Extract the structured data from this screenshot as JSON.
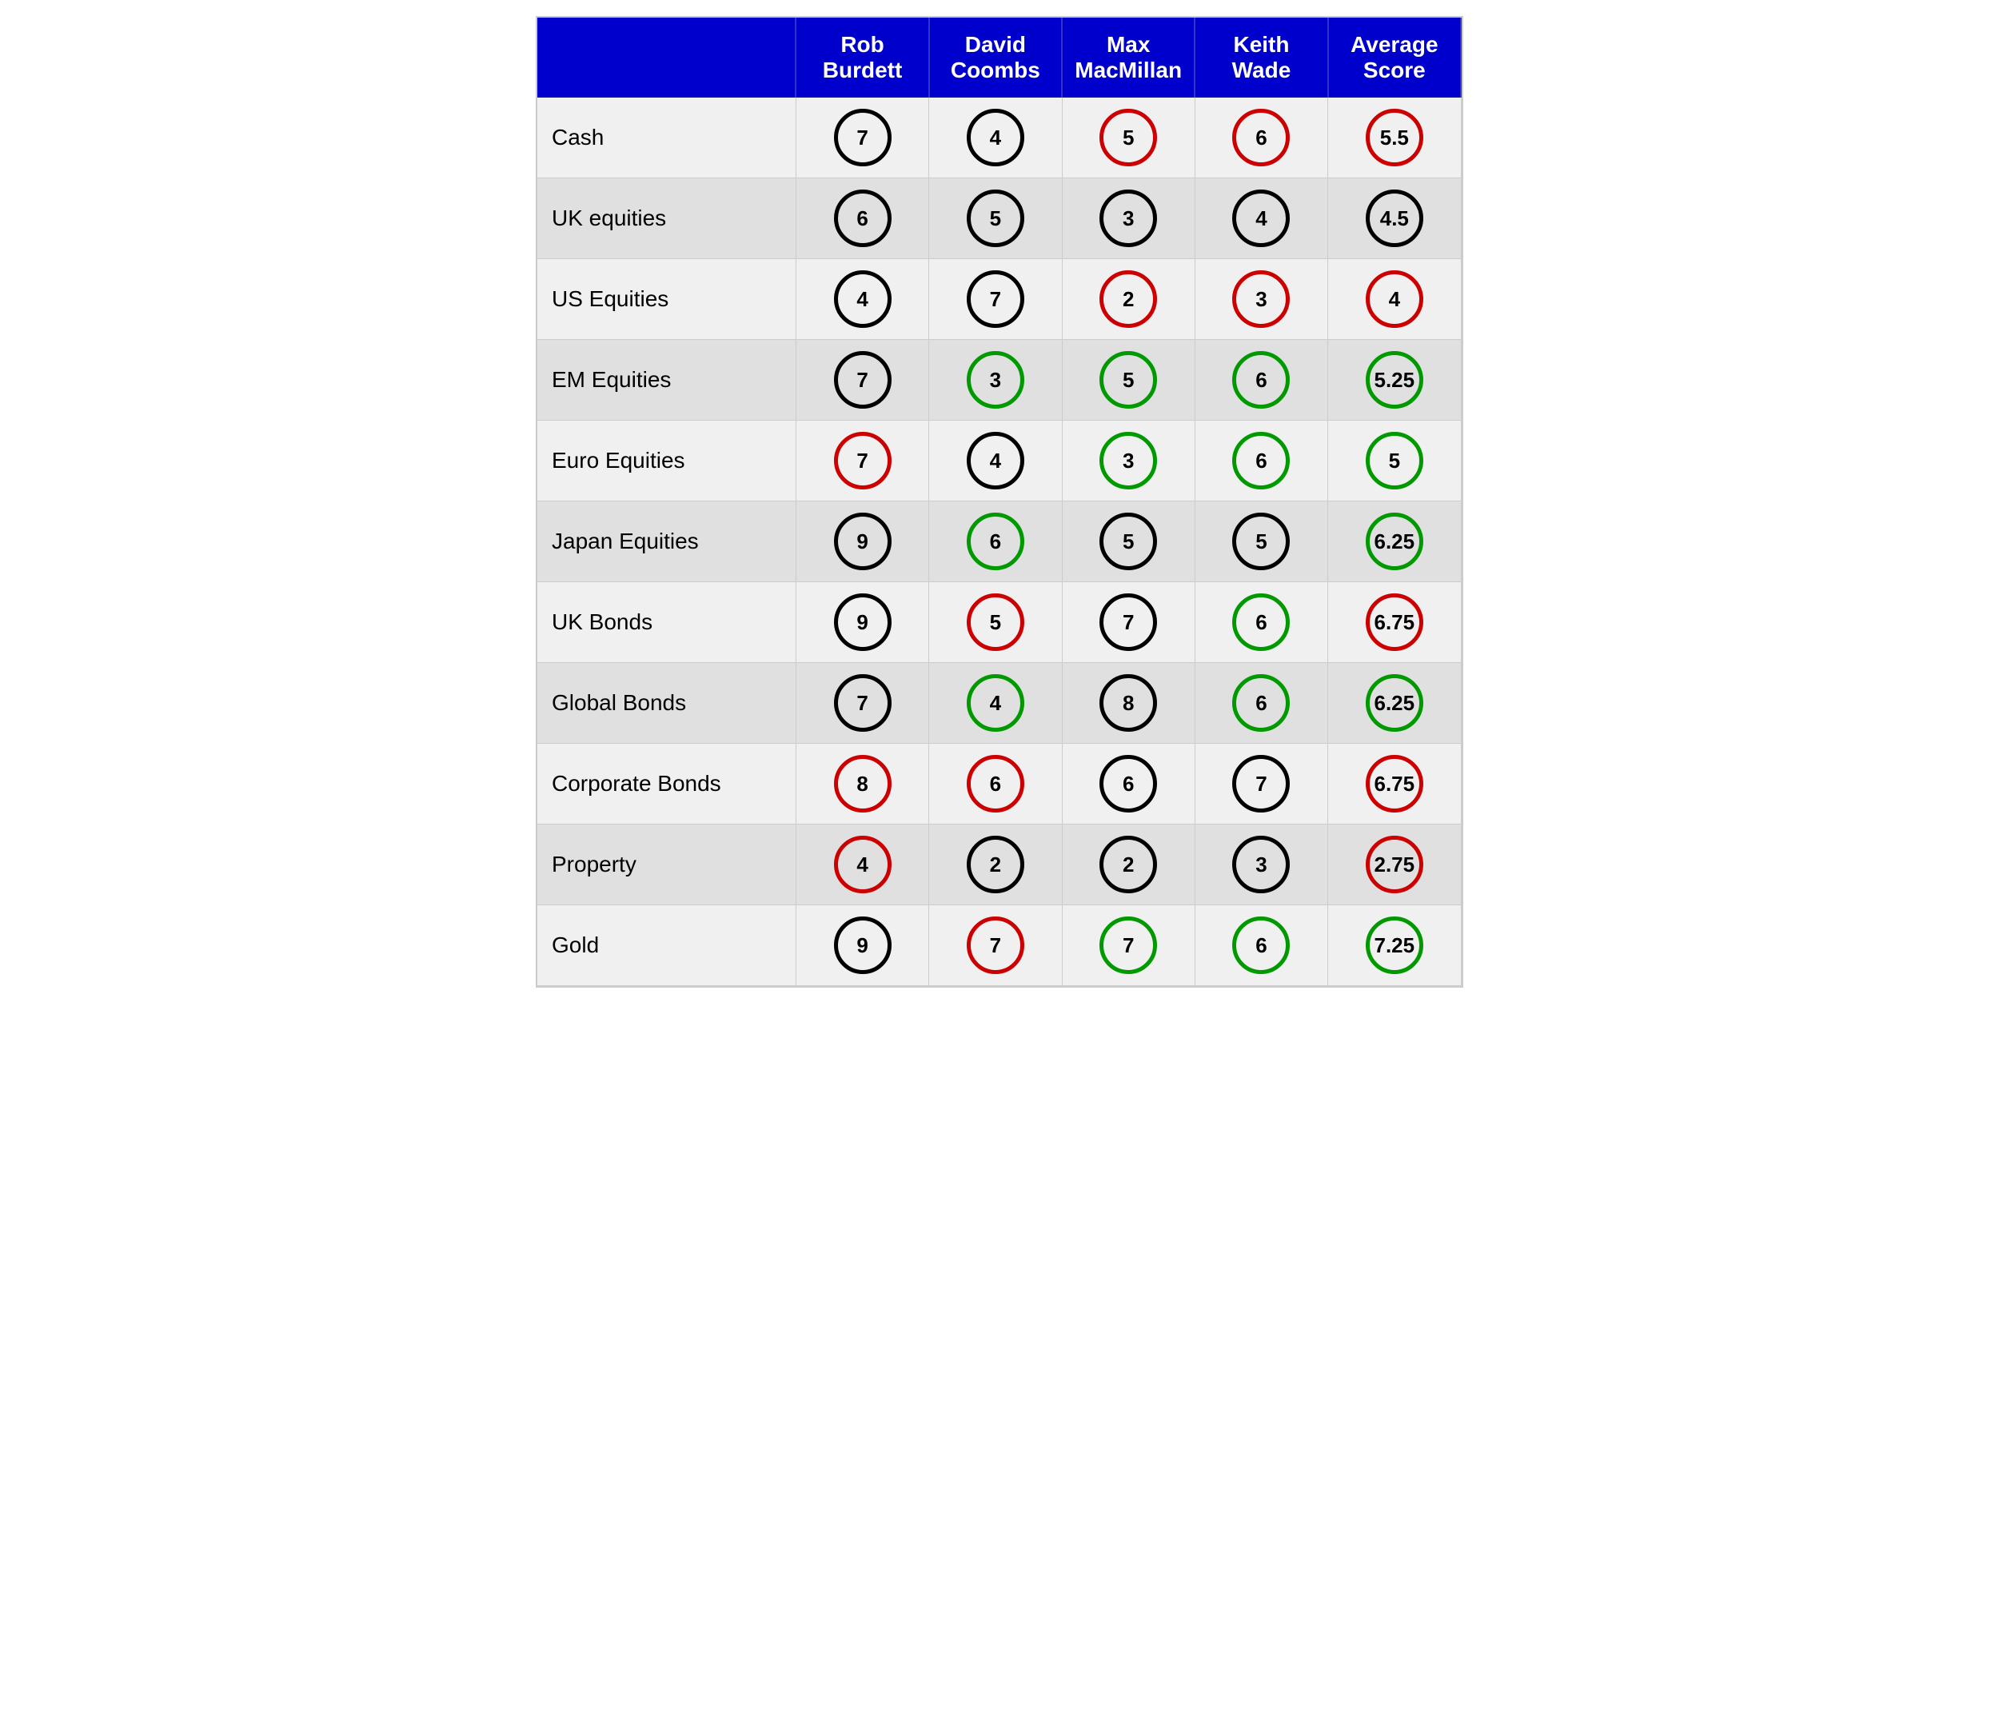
{
  "header": {
    "col0": "",
    "col1": "Rob Burdett",
    "col2": "David Coombs",
    "col3": "Max MacMillan",
    "col4": "Keith Wade",
    "col5": "Average Score"
  },
  "rows": [
    {
      "label": "Cash",
      "v1": "7",
      "c1": "black",
      "v2": "4",
      "c2": "black",
      "v3": "5",
      "c3": "red",
      "v4": "6",
      "c4": "red",
      "v5": "5.5",
      "c5": "red"
    },
    {
      "label": "UK equities",
      "v1": "6",
      "c1": "black",
      "v2": "5",
      "c2": "black",
      "v3": "3",
      "c3": "black",
      "v4": "4",
      "c4": "black",
      "v5": "4.5",
      "c5": "black"
    },
    {
      "label": "US Equities",
      "v1": "4",
      "c1": "black",
      "v2": "7",
      "c2": "black",
      "v3": "2",
      "c3": "red",
      "v4": "3",
      "c4": "red",
      "v5": "4",
      "c5": "red"
    },
    {
      "label": "EM Equities",
      "v1": "7",
      "c1": "black",
      "v2": "3",
      "c2": "green",
      "v3": "5",
      "c3": "green",
      "v4": "6",
      "c4": "green",
      "v5": "5.25",
      "c5": "green"
    },
    {
      "label": "Euro Equities",
      "v1": "7",
      "c1": "red",
      "v2": "4",
      "c2": "black",
      "v3": "3",
      "c3": "green",
      "v4": "6",
      "c4": "green",
      "v5": "5",
      "c5": "green"
    },
    {
      "label": "Japan Equities",
      "v1": "9",
      "c1": "black",
      "v2": "6",
      "c2": "green",
      "v3": "5",
      "c3": "black",
      "v4": "5",
      "c4": "black",
      "v5": "6.25",
      "c5": "green"
    },
    {
      "label": "UK Bonds",
      "v1": "9",
      "c1": "black",
      "v2": "5",
      "c2": "red",
      "v3": "7",
      "c3": "black",
      "v4": "6",
      "c4": "green",
      "v5": "6.75",
      "c5": "red"
    },
    {
      "label": "Global Bonds",
      "v1": "7",
      "c1": "black",
      "v2": "4",
      "c2": "green",
      "v3": "8",
      "c3": "black",
      "v4": "6",
      "c4": "green",
      "v5": "6.25",
      "c5": "green"
    },
    {
      "label": "Corporate Bonds",
      "v1": "8",
      "c1": "red",
      "v2": "6",
      "c2": "red",
      "v3": "6",
      "c3": "black",
      "v4": "7",
      "c4": "black",
      "v5": "6.75",
      "c5": "red"
    },
    {
      "label": "Property",
      "v1": "4",
      "c1": "red",
      "v2": "2",
      "c2": "black",
      "v3": "2",
      "c3": "black",
      "v4": "3",
      "c4": "black",
      "v5": "2.75",
      "c5": "red"
    },
    {
      "label": "Gold",
      "v1": "9",
      "c1": "black",
      "v2": "7",
      "c2": "red",
      "v3": "7",
      "c3": "green",
      "v4": "6",
      "c4": "green",
      "v5": "7.25",
      "c5": "green"
    }
  ]
}
